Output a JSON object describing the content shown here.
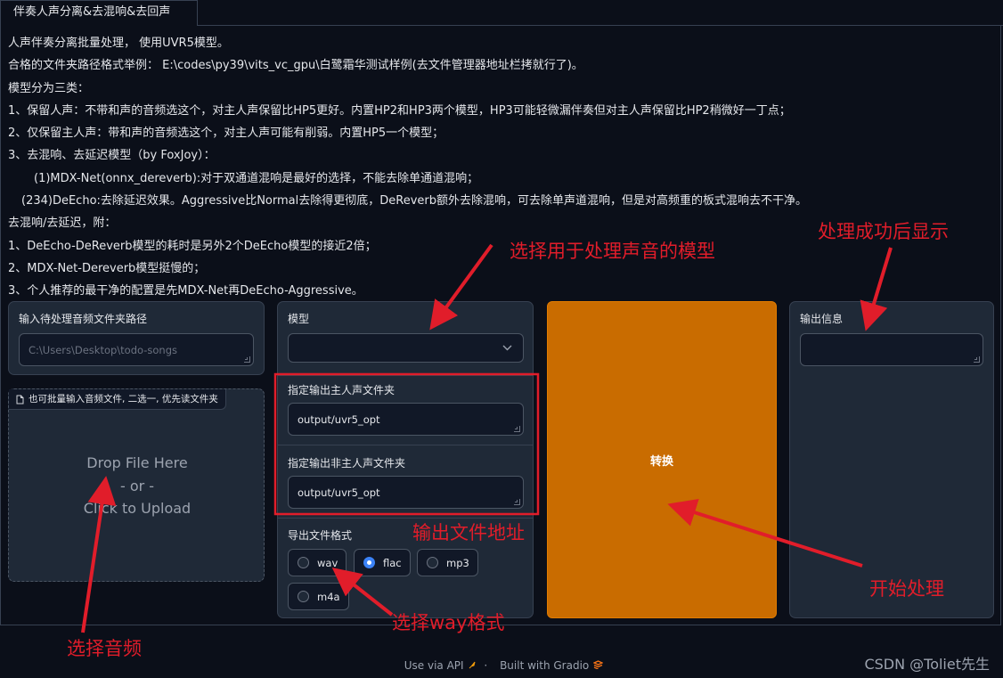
{
  "tab": {
    "label": "伴奏人声分离&去混响&去回声"
  },
  "description": [
    "人声伴奏分离批量处理， 使用UVR5模型。",
    "合格的文件夹路径格式举例： E:\\codes\\py39\\vits_vc_gpu\\白鹭霜华测试样例(去文件管理器地址栏拷就行了)。",
    "模型分为三类：",
    "1、保留人声：不带和声的音频选这个，对主人声保留比HP5更好。内置HP2和HP3两个模型，HP3可能轻微漏伴奏但对主人声保留比HP2稍微好一丁点；",
    "2、仅保留主人声：带和声的音频选这个，对主人声可能有削弱。内置HP5一个模型；",
    "3、去混响、去延迟模型（by FoxJoy）：",
    "(1)MDX-Net(onnx_dereverb):对于双通道混响是最好的选择，不能去除单通道混响；",
    "(234)DeEcho:去除延迟效果。Aggressive比Normal去除得更彻底，DeReverb额外去除混响，可去除单声道混响，但是对高频重的板式混响去不干净。",
    "去混响/去延迟，附：",
    "1、DeEcho-DeReverb模型的耗时是另外2个DeEcho模型的接近2倍；",
    "2、MDX-Net-Dereverb模型挺慢的；",
    "3、个人推荐的最干净的配置是先MDX-Net再DeEcho-Aggressive。"
  ],
  "input_folder": {
    "label": "输入待处理音频文件夹路径",
    "placeholder": "C:\\Users\\Desktop\\todo-songs"
  },
  "upload": {
    "tag": "也可批量输入音频文件, 二选一, 优先读文件夹",
    "drop_text": "Drop File Here",
    "or_text": "- or -",
    "click_text": "Click to Upload"
  },
  "model": {
    "label": "模型",
    "value": ""
  },
  "vocal_output": {
    "label": "指定输出主人声文件夹",
    "value": "output/uvr5_opt"
  },
  "instrumental_output": {
    "label": "指定输出非主人声文件夹",
    "value": "output/uvr5_opt"
  },
  "format": {
    "label": "导出文件格式",
    "options": [
      "wav",
      "flac",
      "mp3",
      "m4a"
    ],
    "selected": "flac"
  },
  "convert_button": {
    "label": "转换"
  },
  "output_info": {
    "label": "输出信息",
    "value": ""
  },
  "footer": {
    "api": "Use via API",
    "separator": "·",
    "built": "Built with Gradio"
  },
  "watermark": "CSDN @Toliet先生",
  "annotations": {
    "model": "选择用于处理声音的模型",
    "success": "处理成功后显示",
    "output_path": "输出文件地址",
    "start": "开始处理",
    "wav_format": "选择way格式",
    "audio": "选择音频"
  },
  "colors": {
    "annotation": "#e11d2a",
    "button": "#c96c00",
    "radio_selected": "#3b82f6",
    "background": "#0b0f19",
    "block": "#1f2937"
  }
}
